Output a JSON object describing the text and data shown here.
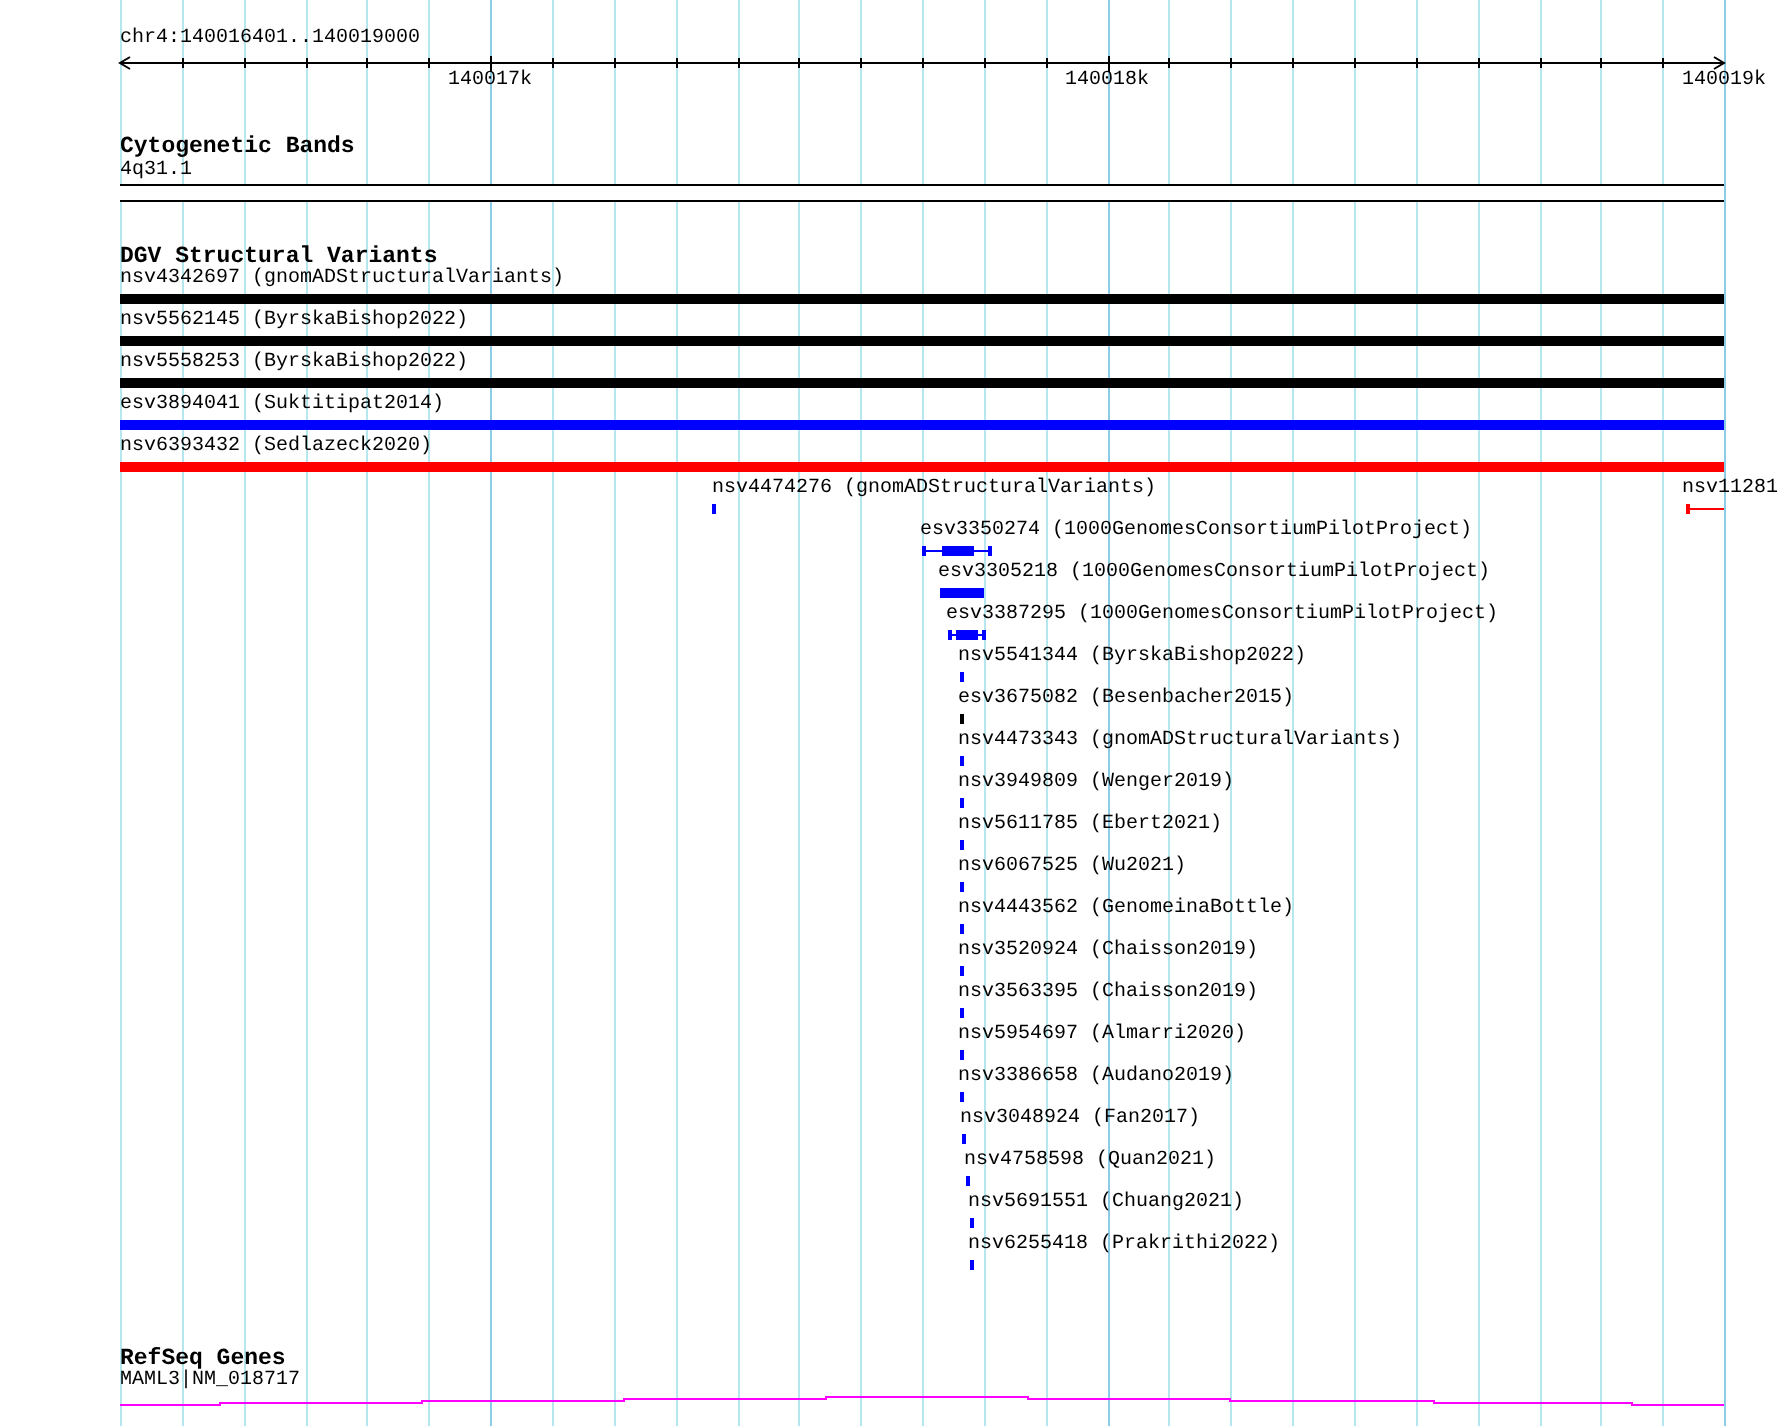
{
  "ruler": {
    "location": "chr4:140016401..140019000",
    "ticks": [
      "140017k",
      "140018k",
      "140019k"
    ]
  },
  "tracks": [
    {
      "kind": "bands",
      "title": "Cytogenetic Bands",
      "items": [
        {
          "label": "4q31.1"
        }
      ]
    },
    {
      "kind": "variants",
      "title": "DGV Structural Variants",
      "features": [
        {
          "label": "nsv4342697 (gnomADStructuralVariants)",
          "color": "#000000"
        },
        {
          "label": "nsv5562145 (ByrskaBishop2022)",
          "color": "#000000"
        },
        {
          "label": "nsv5558253 (ByrskaBishop2022)",
          "color": "#000000"
        },
        {
          "label": "esv3894041 (Suktitipat2014)",
          "color": "#0000ff"
        },
        {
          "label": "nsv6393432 (Sedlazeck2020)",
          "color": "#ff0000"
        },
        {
          "label": "nsv4474276 (gnomADStructuralVariants)",
          "color": "#0000ff"
        },
        {
          "label": "nsv11281",
          "color": "#ff0000"
        },
        {
          "label": "esv3350274 (1000GenomesConsortiumPilotProject)",
          "color": "#0000ff"
        },
        {
          "label": "esv3305218 (1000GenomesConsortiumPilotProject)",
          "color": "#0000ff"
        },
        {
          "label": "esv3387295 (1000GenomesConsortiumPilotProject)",
          "color": "#0000ff"
        },
        {
          "label": "nsv5541344 (ByrskaBishop2022)",
          "color": "#0000ff"
        },
        {
          "label": "esv3675082 (Besenbacher2015)",
          "color": "#000000"
        },
        {
          "label": "nsv4473343 (gnomADStructuralVariants)",
          "color": "#0000ff"
        },
        {
          "label": "nsv3949809 (Wenger2019)",
          "color": "#0000ff"
        },
        {
          "label": "nsv5611785 (Ebert2021)",
          "color": "#0000ff"
        },
        {
          "label": "nsv6067525 (Wu2021)",
          "color": "#0000ff"
        },
        {
          "label": "nsv4443562 (GenomeinaBottle)",
          "color": "#0000ff"
        },
        {
          "label": "nsv3520924 (Chaisson2019)",
          "color": "#0000ff"
        },
        {
          "label": "nsv3563395 (Chaisson2019)",
          "color": "#0000ff"
        },
        {
          "label": "nsv5954697 (Almarri2020)",
          "color": "#0000ff"
        },
        {
          "label": "nsv3386658 (Audano2019)",
          "color": "#0000ff"
        },
        {
          "label": "nsv3048924 (Fan2017)",
          "color": "#0000ff"
        },
        {
          "label": "nsv4758598 (Quan2021)",
          "color": "#0000ff"
        },
        {
          "label": "nsv5691551 (Chuang2021)",
          "color": "#0000ff"
        },
        {
          "label": "nsv6255418 (Prakrithi2022)",
          "color": "#0000ff"
        }
      ]
    },
    {
      "kind": "genes",
      "title": "RefSeq Genes",
      "items": [
        {
          "label": "MAML3|NM_018717",
          "color": "#ff00ff"
        }
      ]
    }
  ]
}
